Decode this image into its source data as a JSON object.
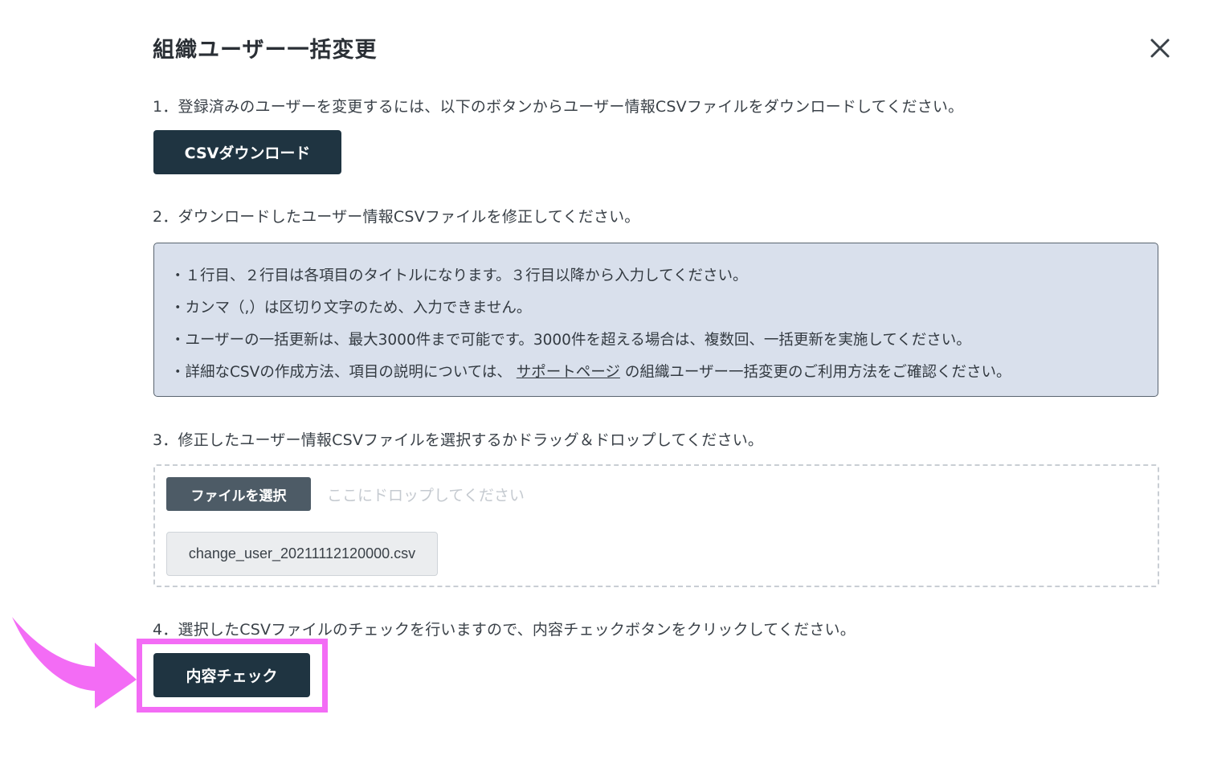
{
  "modal": {
    "title": "組織ユーザー一括変更",
    "close_icon": "close-icon"
  },
  "steps": {
    "step1": "1．登録済みのユーザーを変更するには、以下のボタンからユーザー情報CSVファイルをダウンロードしてください。",
    "step2": "2．ダウンロードしたユーザー情報CSVファイルを修正してください。",
    "step3": "3．修正したユーザー情報CSVファイルを選択するかドラッグ＆ドロップしてください。",
    "step4": "4．選択したCSVファイルのチェックを行いますので、内容チェックボタンをクリックしてください。"
  },
  "buttons": {
    "csv_download": "CSVダウンロード",
    "file_select": "ファイルを選択",
    "content_check": "内容チェック"
  },
  "notice": {
    "line1": "・１行目、２行目は各項目のタイトルになります。３行目以降から入力してください。",
    "line2": "・カンマ（,）は区切り文字のため、入力できません。",
    "line3": "・ユーザーの一括更新は、最大3000件まで可能です。3000件を超える場合は、複数回、一括更新を実施してください。",
    "line4_prefix": "・詳細なCSVの作成方法、項目の説明については、",
    "line4_link": "サポートページ",
    "line4_suffix": "の組織ユーザー一括変更のご利用方法をご確認ください。"
  },
  "dropzone": {
    "placeholder": "ここにドロップしてください",
    "selected_file": "change_user_20211112120000.csv"
  },
  "colors": {
    "dark_button": "#1f3441",
    "file_button": "#4d5b66",
    "notice_bg": "#d9e0ec",
    "highlight": "#f36cf5"
  }
}
